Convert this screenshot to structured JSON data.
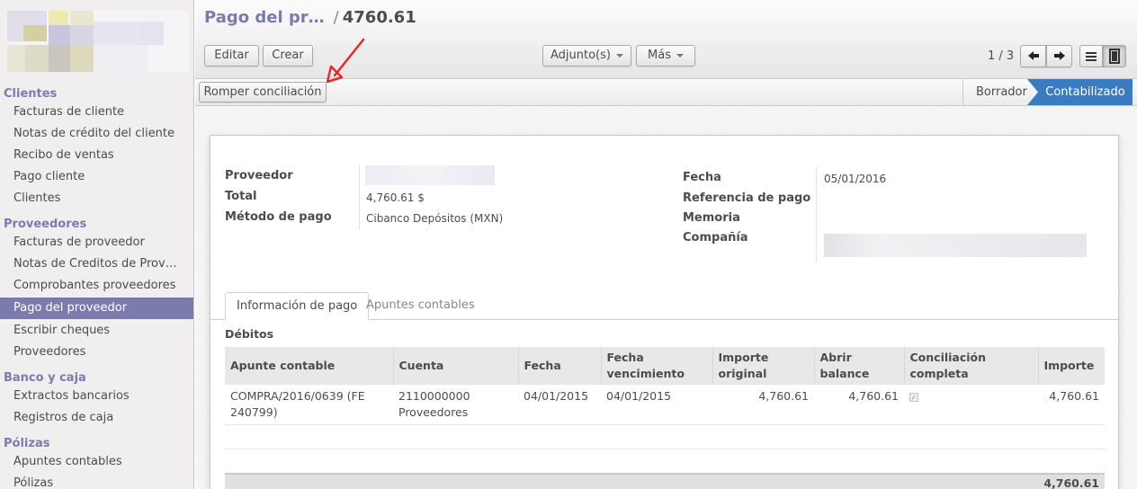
{
  "breadcrumb": {
    "parent": "Pago del pr…",
    "separator": "/",
    "current": "4760.61"
  },
  "toolbar": {
    "edit_label": "Editar",
    "create_label": "Crear",
    "attachments_label": "Adjunto(s)",
    "more_label": "Más",
    "pager": "1 / 3",
    "unreconcile_label": "Romper conciliación"
  },
  "status": {
    "draft": "Borrador",
    "posted": "Contabilizado",
    "current": "Contabilizado"
  },
  "sidebar": {
    "sections": [
      {
        "title": "Clientes",
        "items": [
          "Facturas de cliente",
          "Notas de crédito del cliente",
          "Recibo de ventas",
          "Pago cliente",
          "Clientes"
        ]
      },
      {
        "title": "Proveedores",
        "items": [
          "Facturas de proveedor",
          "Notas de Creditos de Prov…",
          "Comprobantes proveedores",
          "Pago del proveedor",
          "Escribir cheques",
          "Proveedores"
        ]
      },
      {
        "title": "Banco y caja",
        "items": [
          "Extractos bancarios",
          "Registros de caja"
        ]
      },
      {
        "title": "Pólizas",
        "items": [
          "Apuntes contables",
          "Pólizas"
        ]
      }
    ],
    "active_item": "Pago del proveedor"
  },
  "form": {
    "partner_label": "Proveedor",
    "total_label": "Total",
    "total_value": "4,760.61 $",
    "method_label": "Método de pago",
    "method_value": "Cibanco Depósitos (MXN)",
    "date_label": "Fecha",
    "date_value": "05/01/2016",
    "ref_label": "Referencia de pago",
    "memo_label": "Memoria",
    "company_label": "Compañía"
  },
  "tabs": {
    "payment_info": "Información de pago",
    "journal_items": "Apuntes contables"
  },
  "debits": {
    "title": "Débitos",
    "columns": [
      "Apunte contable",
      "Cuenta",
      "Fecha",
      "Fecha vencimiento",
      "Importe original",
      "Abrir balance",
      "Conciliación completa",
      "Importe"
    ],
    "rows": [
      {
        "move_line": "COMPRA/2016/0639 (FE 240799)",
        "account": "2110000000 Proveedores",
        "date": "04/01/2015",
        "due_date": "04/01/2015",
        "original_amount": "4,760.61",
        "open_balance": "4,760.61",
        "full_reconcile": true,
        "amount": "4,760.61"
      }
    ],
    "total": "4,760.61"
  },
  "colors": {
    "accent": "#7c7bad",
    "status_active": "#3b7bbf",
    "annotation_arrow": "#e8272b"
  }
}
